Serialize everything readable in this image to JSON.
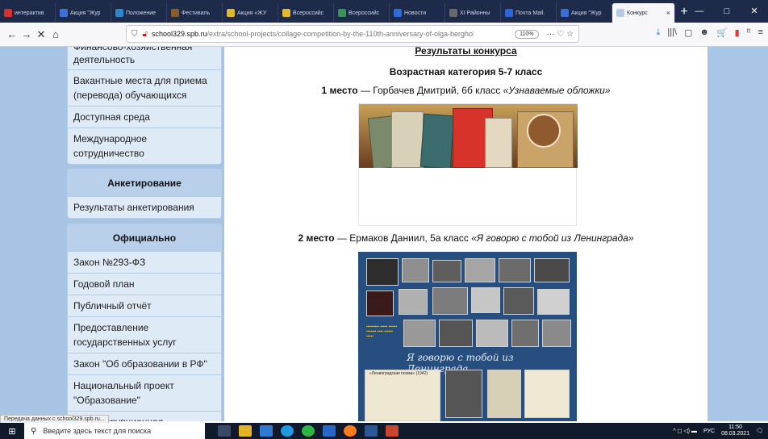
{
  "browser": {
    "tabs": [
      {
        "label": "интерактив",
        "color": "#d92f2f"
      },
      {
        "label": "Акция \"Жур",
        "color": "#3a6fd8"
      },
      {
        "label": "Положение",
        "color": "#2d86c8"
      },
      {
        "label": "Фестиваль",
        "color": "#8a5c2d"
      },
      {
        "label": "Акция «ЖУ",
        "color": "#e0b92c"
      },
      {
        "label": "Всероссийс",
        "color": "#e0b92c"
      },
      {
        "label": "Всероссийс",
        "color": "#3b8f57"
      },
      {
        "label": "Новости",
        "color": "#2e6bd6"
      },
      {
        "label": "XI Районны",
        "color": "#6a6a6a"
      },
      {
        "label": "Почта Mail.",
        "color": "#2c66d8"
      },
      {
        "label": "Акция \"Жур",
        "color": "#3a6fd8"
      }
    ],
    "active_tab": {
      "label": "Конкурс",
      "close": "×"
    },
    "new_tab": "+",
    "window_controls": [
      "—",
      "□",
      "✕"
    ],
    "nav": {
      "back": "←",
      "forward": "→",
      "stop": "✕",
      "home": "⌂"
    },
    "url_host": "school329.spb.ru",
    "url_path": "/extra/school-projects/collage-competition-by-the-110th-anniversary-of-olga-bergholz.html",
    "zoom": "110%",
    "url_more": "··· ♡ ☆",
    "toolbar_icons": [
      "⤓",
      "|||\\",
      "▢",
      "☻",
      "🛒",
      "▮",
      "ᵗᵗ",
      "≡"
    ]
  },
  "sidebar": {
    "top_menu": {
      "partial_line": "Финансово-хозяйственная",
      "items": [
        "деятельность",
        "Вакантные места для приема (перевода) обучающихся",
        "Доступная среда",
        "Международное сотрудничество"
      ]
    },
    "survey": {
      "header": "Анкетирование",
      "items": [
        "Результаты анкетирования"
      ]
    },
    "official": {
      "header": "Официально",
      "items": [
        "Закон №293-ФЗ",
        "Годовой план",
        "Публичный отчёт",
        "Предоставление государственных услуг",
        "Закон \"Об образовании в РФ\"",
        "Национальный проект \"Образование\"",
        "Антикоррупционная"
      ]
    }
  },
  "content": {
    "results_title": "Результаты конкурса",
    "category_title": "Возрастная категория 5-7 класс",
    "place1": {
      "place": "1 место",
      "text": " — Горбачев Дмитрий, 6б класс ",
      "work": "«Узнаваемые обложки»"
    },
    "place2": {
      "place": "2 место",
      "text": " — Ермаков Даниил, 5а класс ",
      "work": "«Я говорю с тобой из Ленинграда»"
    },
    "collage2_script": "Я говорю с тобой из Ленинграда",
    "collage2_caption": "«Ленинградская поэма» (1942)"
  },
  "status_text": "Передача данных с school329.spb.ru...",
  "taskbar": {
    "start_icon": "⊞",
    "search_placeholder": "Введите здесь текст для поиска",
    "tray_icons": "^ ◻ ◁) ▬",
    "language": "РУС",
    "time": "11:50",
    "date": "08.03.2021"
  },
  "colors": {
    "sidebar_bg": "#a7c4e4",
    "menu_bg": "#dfeaf7",
    "menu_header_bg": "#b9d0ea",
    "collage2_bg": "#264f7f"
  }
}
